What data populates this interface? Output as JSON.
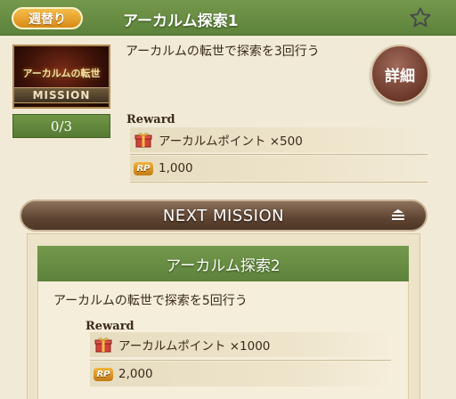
{
  "current_mission": {
    "badge": "週替り",
    "title": "アーカルム探索1",
    "description": "アーカルムの転世で探索を3回行う",
    "thumbnail_title": "アーカルムの転世",
    "thumbnail_band": "MISSION",
    "progress": "0/3",
    "detail_button": "詳細",
    "reward_label": "Reward",
    "rewards": [
      {
        "icon": "gift-icon",
        "text": "アーカルムポイント ×500"
      },
      {
        "icon": "rp-icon",
        "icon_text": "RP",
        "text": "1,000"
      }
    ]
  },
  "next_mission_bar": {
    "label": "NEXT MISSION"
  },
  "next_mission": {
    "title": "アーカルム探索2",
    "description": "アーカルムの転世で探索を5回行う",
    "reward_label": "Reward",
    "rewards": [
      {
        "icon": "gift-icon",
        "text": "アーカルムポイント ×1000"
      },
      {
        "icon": "rp-icon",
        "icon_text": "RP",
        "text": "2,000"
      }
    ]
  },
  "colors": {
    "header_green": "#6a8f44",
    "badge_orange": "#e9a22f",
    "next_bar_brown": "#5e4432",
    "background": "#f1ead6"
  }
}
